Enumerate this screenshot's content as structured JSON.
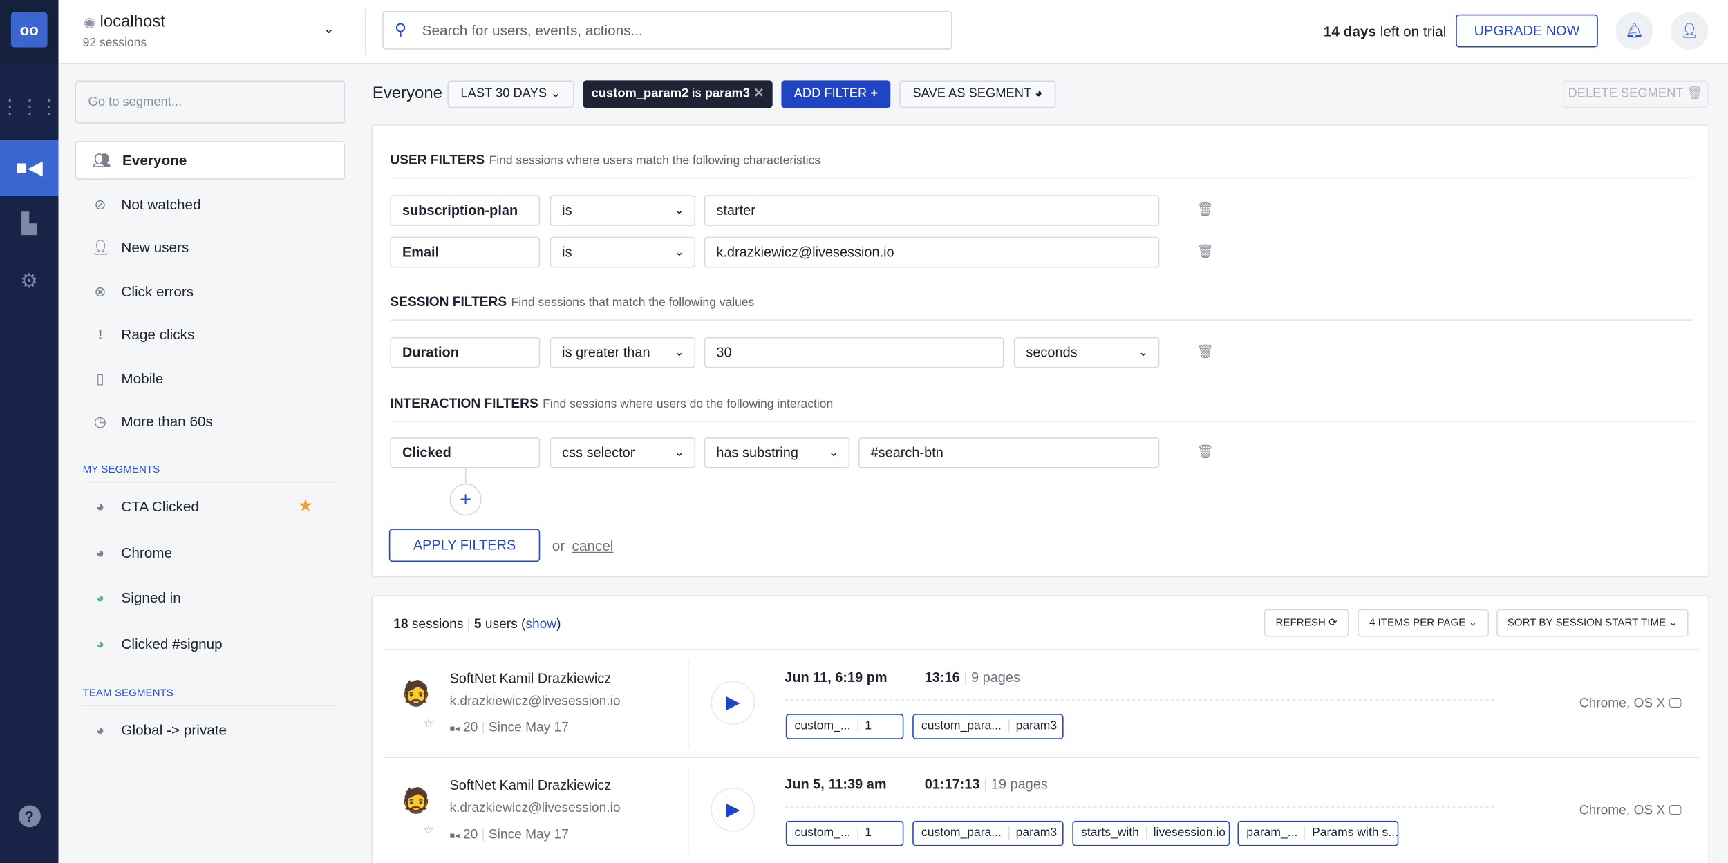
{
  "nav": {
    "items": [
      "apps",
      "sessions",
      "analytics",
      "settings",
      "help"
    ]
  },
  "header": {
    "site": "localhost",
    "sessions": "92 sessions",
    "search_placeholder": "Search for users, events, actions...",
    "trial_days": "14 days",
    "trial_rest": "left on trial",
    "upgrade": "UPGRADE NOW"
  },
  "segments": {
    "placeholder": "Go to segment...",
    "items": [
      {
        "label": "Everyone",
        "icon": "users-icon"
      },
      {
        "label": "Not watched",
        "icon": "eye-off-icon"
      },
      {
        "label": "New users",
        "icon": "user-plus-icon"
      },
      {
        "label": "Click errors",
        "icon": "x-circle-icon"
      },
      {
        "label": "Rage clicks",
        "icon": "exclamation-icon"
      },
      {
        "label": "Mobile",
        "icon": "mobile-icon"
      },
      {
        "label": "More than 60s",
        "icon": "clock-icon"
      }
    ],
    "my_title": "MY SEGMENTS",
    "my": [
      "CTA Clicked",
      "Chrome",
      "Signed in",
      "Clicked #signup"
    ],
    "team_title": "TEAM SEGMENTS",
    "team": [
      "Global -> private"
    ]
  },
  "toolbar": {
    "title": "Everyone",
    "range": "LAST 30 DAYS",
    "chip_key": "custom_param2",
    "chip_op": "is",
    "chip_val": "param3",
    "add_filter": "ADD FILTER",
    "save_segment": "SAVE AS SEGMENT",
    "delete_segment": "DELETE SEGMENT"
  },
  "filters": {
    "user_title": "USER FILTERS",
    "user_desc": "Find sessions where users match the following characteristics",
    "user": [
      {
        "field": "subscription-plan",
        "op": "is",
        "value": "starter"
      },
      {
        "field": "Email",
        "op": "is",
        "value": "k.drazkiewicz@livesession.io"
      }
    ],
    "session_title": "SESSION FILTERS",
    "session_desc": "Find sessions that match the following values",
    "session": {
      "field": "Duration",
      "op": "is greater than",
      "value": "30",
      "unit": "seconds"
    },
    "interaction_title": "INTERACTION FILTERS",
    "interaction_desc": "Find sessions where users do the following interaction",
    "interaction": {
      "field": "Clicked",
      "type": "css selector",
      "op": "has substring",
      "value": "#search-btn"
    },
    "apply": "APPLY FILTERS",
    "or": "or",
    "cancel": "cancel"
  },
  "list": {
    "sessions_count": "18",
    "sessions_label": "sessions",
    "users_count": "5",
    "users_label": "users",
    "show": "show",
    "refresh": "REFRESH",
    "per_page": "4 ITEMS PER PAGE",
    "sort": "SORT BY SESSION START TIME",
    "rows": [
      {
        "name": "SoftNet Kamil Drazkiewicz",
        "email": "k.drazkiewicz@livesession.io",
        "count": "20",
        "since": "Since May 17",
        "date": "Jun 11, 6:19 pm",
        "duration": "13:16",
        "pages": "9 pages",
        "env": "Chrome, OS X",
        "tags": [
          [
            "custom_...",
            "1"
          ],
          [
            "custom_para...",
            "param3"
          ]
        ]
      },
      {
        "name": "SoftNet Kamil Drazkiewicz",
        "email": "k.drazkiewicz@livesession.io",
        "count": "20",
        "since": "Since May 17",
        "date": "Jun 5, 11:39 am",
        "duration": "01:17:13",
        "pages": "19 pages",
        "env": "Chrome, OS X",
        "tags": [
          [
            "custom_...",
            "1"
          ],
          [
            "custom_para...",
            "param3"
          ],
          [
            "starts_with",
            "livesession.io"
          ],
          [
            "param_...",
            "Params with s..."
          ]
        ]
      }
    ]
  }
}
